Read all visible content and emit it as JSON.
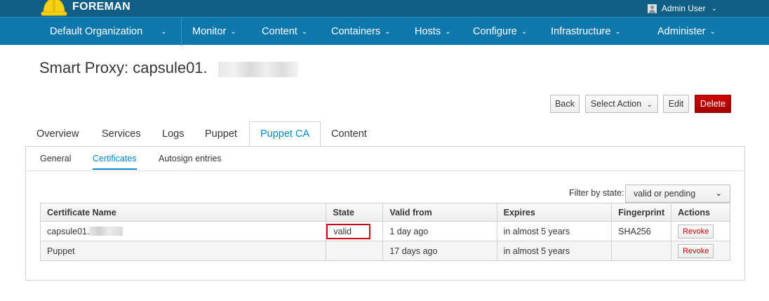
{
  "brand": {
    "name": "FOREMAN"
  },
  "user": {
    "name": "Admin User",
    "caret": "⌄"
  },
  "nav": {
    "organization": "Default Organization",
    "items": [
      {
        "label": "Monitor"
      },
      {
        "label": "Content"
      },
      {
        "label": "Containers"
      },
      {
        "label": "Hosts"
      },
      {
        "label": "Configure"
      },
      {
        "label": "Infrastructure"
      },
      {
        "label": "Administer"
      }
    ],
    "chevron": "⌄"
  },
  "page": {
    "title": "Smart Proxy: capsule01."
  },
  "actions": {
    "back": "Back",
    "select_action": "Select Action",
    "select_caret": "⌄",
    "edit": "Edit",
    "delete": "Delete"
  },
  "tabs": [
    "Overview",
    "Services",
    "Logs",
    "Puppet",
    "Puppet CA",
    "Content"
  ],
  "active_tab": "Puppet CA",
  "subtabs": [
    "General",
    "Certificates",
    "Autosign entries"
  ],
  "active_subtab": "Certificates",
  "filter": {
    "label": "Filter by state:",
    "value": "valid or pending",
    "caret": "⌄"
  },
  "table": {
    "headers": [
      "Certificate Name",
      "State",
      "Valid from",
      "Expires",
      "Fingerprint",
      "Actions"
    ],
    "rows": [
      {
        "name": "capsule01.",
        "state": "valid",
        "valid_from": "1 day ago",
        "expires": "in almost 5 years",
        "fingerprint": "SHA256",
        "action": "Revoke"
      },
      {
        "name": "Puppet",
        "state": "",
        "valid_from": "17 days ago",
        "expires": "in almost 5 years",
        "fingerprint": "",
        "action": "Revoke"
      }
    ]
  },
  "colors": {
    "topbar": "#0e5e86",
    "navbar": "#0e78ad",
    "accent": "#0088ce",
    "danger": "#cc0000",
    "highlight": "#d0021b"
  },
  "icons": {
    "logo": "foreman-helmet-icon",
    "avatar": "user-avatar-icon",
    "chevron": "chevron-down-icon"
  }
}
